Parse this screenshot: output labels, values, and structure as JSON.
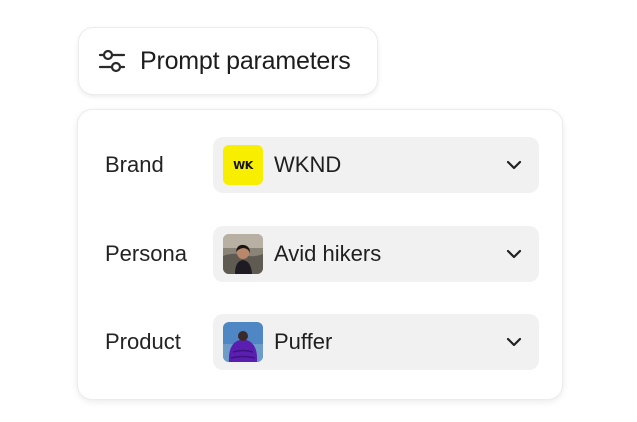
{
  "header": {
    "title": "Prompt parameters",
    "icon": "sliders-icon"
  },
  "fields": [
    {
      "label": "Brand",
      "value": "WKND",
      "thumb_text": "WK",
      "thumb_color": "#f8ee00"
    },
    {
      "label": "Persona",
      "value": "Avid hikers",
      "thumb_icon": "hiker-avatar-icon"
    },
    {
      "label": "Product",
      "value": "Puffer",
      "thumb_icon": "puffer-jacket-icon"
    }
  ],
  "colors": {
    "select_bg": "#f1f1f1",
    "card_bg": "#ffffff",
    "brand_yellow": "#f8ee00",
    "jacket_purple": "#5a1fb0"
  }
}
